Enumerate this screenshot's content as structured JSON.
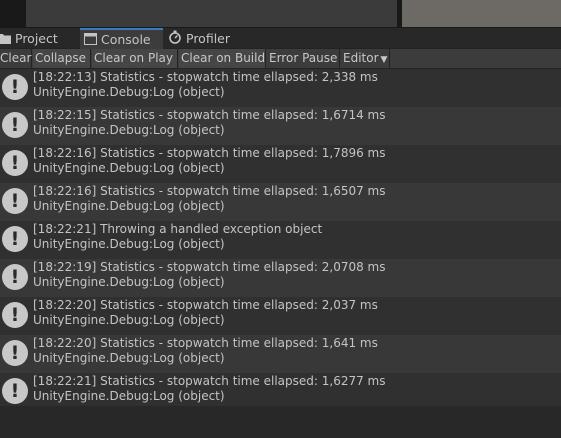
{
  "tabs": [
    {
      "label": "Project",
      "icon": "folder-icon"
    },
    {
      "label": "Console",
      "icon": "console-icon"
    },
    {
      "label": "Profiler",
      "icon": "profiler-icon"
    }
  ],
  "toolbar": {
    "clear": "Clear",
    "collapse": "Collapse",
    "clear_on_play": "Clear on Play",
    "clear_on_build": "Clear on Build",
    "error_pause": "Error Pause",
    "editor": "Editor"
  },
  "log": [
    {
      "line1": "[18:22:13] Statistics - stopwatch time ellapsed: 2,338 ms",
      "line2": "UnityEngine.Debug:Log (object)"
    },
    {
      "line1": "[18:22:15] Statistics - stopwatch time ellapsed: 1,6714 ms",
      "line2": "UnityEngine.Debug:Log (object)"
    },
    {
      "line1": "[18:22:16] Statistics - stopwatch time ellapsed: 1,7896 ms",
      "line2": "UnityEngine.Debug:Log (object)"
    },
    {
      "line1": "[18:22:16] Statistics - stopwatch time ellapsed: 1,6507 ms",
      "line2": "UnityEngine.Debug:Log (object)"
    },
    {
      "line1": "[18:22:21] Throwing a handled exception object",
      "line2": "UnityEngine.Debug:Log (object)"
    },
    {
      "line1": "[18:22:19] Statistics - stopwatch time ellapsed: 2,0708 ms",
      "line2": "UnityEngine.Debug:Log (object)"
    },
    {
      "line1": "[18:22:20] Statistics - stopwatch time ellapsed: 2,037 ms",
      "line2": "UnityEngine.Debug:Log (object)"
    },
    {
      "line1": "[18:22:20] Statistics - stopwatch time ellapsed: 1,641 ms",
      "line2": "UnityEngine.Debug:Log (object)"
    },
    {
      "line1": "[18:22:21] Statistics - stopwatch time ellapsed: 1,6277 ms",
      "line2": "UnityEngine.Debug:Log (object)"
    }
  ],
  "log_icon": "info-message-icon",
  "colors": {
    "accent": "#3a79bb",
    "background": "#282828",
    "toolbar": "#3c3c3c"
  }
}
